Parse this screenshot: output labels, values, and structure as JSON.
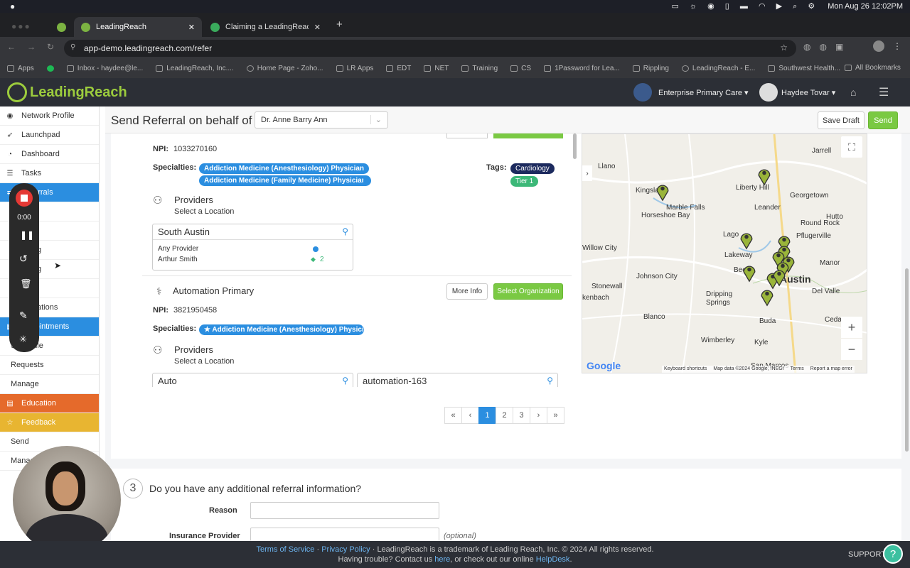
{
  "mac": {
    "datetime": "Mon Aug 26 12:02PM"
  },
  "browser": {
    "tabs": [
      {
        "title": "LeadingReach"
      },
      {
        "title": "Claiming a LeadingReach Fax"
      }
    ],
    "url": "app-demo.leadingreach.com/refer",
    "bookmarks": [
      "Apps",
      "Inbox - haydee@le...",
      "LeadingReach, Inc....",
      "Home Page - Zoho...",
      "LR Apps",
      "EDT",
      "NET",
      "Training",
      "CS",
      "1Password for Lea...",
      "Rippling",
      "LeadingReach - E...",
      "Southwest Health..."
    ],
    "all_bookmarks": "All Bookmarks"
  },
  "app": {
    "logo": "LeadingReach",
    "org": "Enterprise Primary Care",
    "user": "Haydee Tovar"
  },
  "sidebar": {
    "items": [
      {
        "label": "Network Profile"
      },
      {
        "label": "Launchpad"
      },
      {
        "label": "Dashboard"
      },
      {
        "label": "Tasks"
      },
      {
        "label": "Referrals"
      },
      {
        "label": ""
      },
      {
        "label": ""
      },
      {
        "label": "g"
      },
      {
        "label": "g"
      },
      {
        "label": ""
      },
      {
        "label": "ations"
      },
      {
        "label": "Appointments"
      },
      {
        "label": "Schedule"
      },
      {
        "label": "Requests"
      },
      {
        "label": "Manage"
      },
      {
        "label": "Education"
      },
      {
        "label": "Feedback"
      },
      {
        "label": "Send"
      },
      {
        "label": "Manage"
      }
    ]
  },
  "recorder": {
    "time": "0:00"
  },
  "topbar": {
    "title": "Send Referral on behalf of",
    "on_behalf": "Dr. Anne Barry Ann",
    "save_draft": "Save Draft",
    "send": "Send"
  },
  "org1": {
    "npi_label": "NPI:",
    "npi": "1033270160",
    "specialties_label": "Specialties:",
    "specialties": [
      "Addiction Medicine (Anesthesiology) Physician",
      "Addiction Medicine (Family Medicine) Physician"
    ],
    "tags_label": "Tags:",
    "tags": [
      "Cardiology",
      "Tier 1"
    ],
    "providers_label": "Providers",
    "select_location": "Select a Location",
    "location": {
      "name": "South Austin",
      "any_provider": "Any Provider",
      "provider": "Arthur Smith",
      "count": "2"
    }
  },
  "org2": {
    "name": "Automation Primary",
    "more_info": "More Info",
    "select_org": "Select Organization",
    "npi_label": "NPI:",
    "npi": "3821950458",
    "specialties_label": "Specialties:",
    "specialty": "Addiction Medicine (Anesthesiology) Physici...",
    "providers_label": "Providers",
    "select_location": "Select a Location",
    "locations": [
      "Auto",
      "automation-163"
    ]
  },
  "pagination": {
    "pages": [
      "«",
      "‹",
      "1",
      "2",
      "3",
      "›",
      "»"
    ],
    "current": "1"
  },
  "map": {
    "places": [
      "Llano",
      "Jarrell",
      "Liberty Hill",
      "Georgetown",
      "Kingsland",
      "Marble Falls",
      "Horseshoe Bay",
      "Leander",
      "Hutto",
      "Round Rock",
      "Lago",
      "Pflugerville",
      "Willow City",
      "Lakeway",
      "Bee",
      "Manor",
      "Johnson City",
      "Austin",
      "Stonewall",
      "Dripping Springs",
      "Del Valle",
      "kenbach",
      "Blanco",
      "Buda",
      "Cedar C",
      "Wimberley",
      "Kyle",
      "San Marcos"
    ],
    "credits": [
      "Keyboard shortcuts",
      "Map data ©2024 Google, INEGI",
      "Terms",
      "Report a map error"
    ],
    "google": "Google",
    "zoom_in": "+",
    "zoom_out": "−"
  },
  "section3": {
    "number": "3",
    "title": "Do you have any additional referral information?",
    "reason_label": "Reason",
    "insurance_label": "Insurance Provider",
    "optional": "(optional)"
  },
  "footer": {
    "terms": "Terms of Service",
    "privacy": "Privacy Policy",
    "trademark": " · LeadingReach is a trademark of Leading Reach, Inc. © 2024 All rights reserved.",
    "trouble": "Having trouble? Contact us ",
    "here": "here",
    "checkout": ", or check out our online ",
    "helpdesk": "HelpDesk",
    "period": ".",
    "support": "SUPPORT"
  }
}
